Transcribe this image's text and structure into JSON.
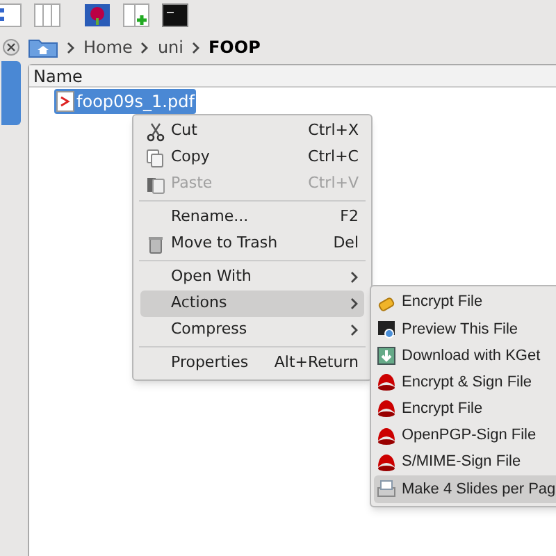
{
  "breadcrumb": [
    {
      "label": "Home",
      "current": false
    },
    {
      "label": "uni",
      "current": false
    },
    {
      "label": "FOOP",
      "current": true
    }
  ],
  "file_list": {
    "column": "Name",
    "files": [
      {
        "name": "foop09s_1.pdf",
        "selected": true
      }
    ]
  },
  "context_menu": {
    "items": [
      {
        "kind": "item",
        "label": "Cut",
        "shortcut": "Ctrl+X",
        "disabled": false,
        "selected": false
      },
      {
        "kind": "item",
        "label": "Copy",
        "shortcut": "Ctrl+C",
        "disabled": false,
        "selected": false
      },
      {
        "kind": "item",
        "label": "Paste",
        "shortcut": "Ctrl+V",
        "disabled": true,
        "selected": false
      },
      {
        "kind": "separator"
      },
      {
        "kind": "item",
        "label": "Rename...",
        "shortcut": "F2",
        "disabled": false,
        "selected": false
      },
      {
        "kind": "item",
        "label": "Move to Trash",
        "shortcut": "Del",
        "disabled": false,
        "selected": false
      },
      {
        "kind": "separator"
      },
      {
        "kind": "submenu",
        "label": "Open With",
        "selected": false
      },
      {
        "kind": "submenu",
        "label": "Actions",
        "selected": true
      },
      {
        "kind": "submenu",
        "label": "Compress",
        "selected": false
      },
      {
        "kind": "separator"
      },
      {
        "kind": "item",
        "label": "Properties",
        "shortcut": "Alt+Return",
        "disabled": false,
        "selected": false
      }
    ]
  },
  "actions_submenu": {
    "items": [
      {
        "label": "Encrypt File",
        "selected": false
      },
      {
        "label": "Preview This File",
        "selected": false
      },
      {
        "label": "Download with KGet",
        "selected": false
      },
      {
        "label": "Encrypt & Sign File",
        "selected": false
      },
      {
        "label": "Encrypt File",
        "selected": false
      },
      {
        "label": "OpenPGP-Sign File",
        "selected": false
      },
      {
        "label": "S/MIME-Sign File",
        "selected": false
      },
      {
        "label": "Make 4 Slides per Pag",
        "selected": true
      }
    ]
  }
}
